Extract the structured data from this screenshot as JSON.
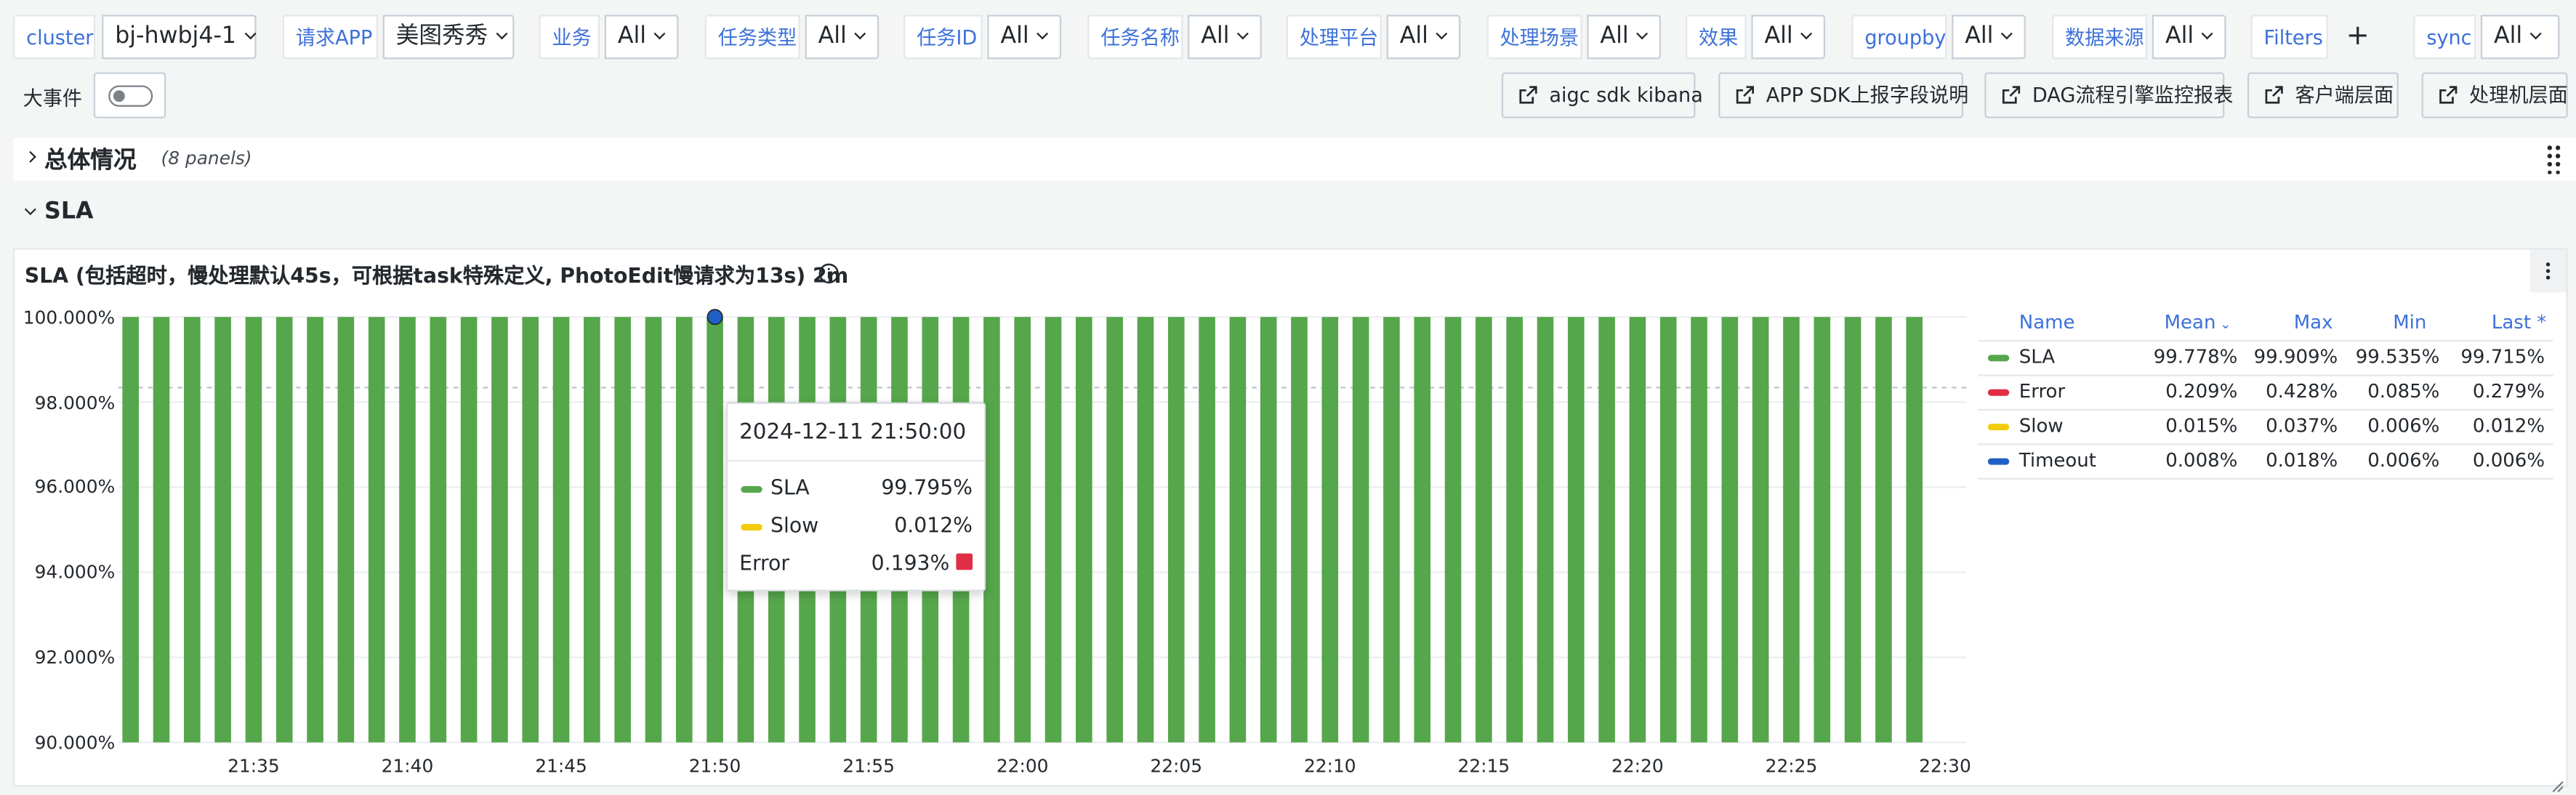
{
  "variables": {
    "cluster": {
      "label": "cluster",
      "value": "bj-hwbj4-1"
    },
    "app": {
      "label": "请求APP",
      "value": "美图秀秀"
    },
    "business": {
      "label": "业务",
      "value": "All"
    },
    "task_type": {
      "label": "任务类型",
      "value": "All"
    },
    "task_id": {
      "label": "任务ID",
      "value": "All"
    },
    "task_name": {
      "label": "任务名称",
      "value": "All"
    },
    "platform": {
      "label": "处理平台",
      "value": "All"
    },
    "scene": {
      "label": "处理场景",
      "value": "All"
    },
    "effect": {
      "label": "效果",
      "value": "All"
    },
    "groupby": {
      "label": "groupby",
      "value": "All"
    },
    "source": {
      "label": "数据来源",
      "value": "All"
    },
    "filters": {
      "label": "Filters",
      "add": "+"
    },
    "sync": {
      "label": "sync",
      "value": "All"
    },
    "big_event": {
      "label": "大事件"
    }
  },
  "links": {
    "kibana": "aigc sdk kibana",
    "sdk": "APP SDK上报字段说明",
    "dag": "DAG流程引擎监控报表",
    "client": "客户端层面",
    "handler": "处理机层面"
  },
  "rows": {
    "overview": {
      "title": "总体情况",
      "count": "(8 panels)"
    },
    "sla": {
      "title": "SLA"
    }
  },
  "panel": {
    "title": "SLA (包括超时，慢处理默认45s，可根据task特殊定义, PhotoEdit慢请求为13s) 2m"
  },
  "legend": {
    "headers": {
      "name": "Name",
      "mean": "Mean",
      "max": "Max",
      "min": "Min",
      "last": "Last *"
    },
    "rows": [
      {
        "name": "SLA",
        "color": "#56a64b",
        "mean": "99.778%",
        "max": "99.909%",
        "min": "99.535%",
        "last": "99.715%"
      },
      {
        "name": "Error",
        "color": "#e02f44",
        "mean": "0.209%",
        "max": "0.428%",
        "min": "0.085%",
        "last": "0.279%"
      },
      {
        "name": "Slow",
        "color": "#f2cc0c",
        "mean": "0.015%",
        "max": "0.037%",
        "min": "0.006%",
        "last": "0.012%"
      },
      {
        "name": "Timeout",
        "color": "#1f60c4",
        "mean": "0.008%",
        "max": "0.018%",
        "min": "0.006%",
        "last": "0.006%"
      }
    ]
  },
  "tooltip": {
    "time": "2024-12-11 21:50:00",
    "rows": [
      {
        "name": "SLA",
        "value": "99.795%",
        "color": "#56a64b"
      },
      {
        "name": "Slow",
        "value": "0.012%",
        "color": "#f2cc0c"
      },
      {
        "name": "Error",
        "value": "0.193%",
        "color": "#e02f44"
      }
    ]
  },
  "chart_data": {
    "type": "bar",
    "stacked": true,
    "ylim": [
      90,
      100
    ],
    "y_ticks": [
      "100.000%",
      "98.000%",
      "96.000%",
      "94.000%",
      "92.000%",
      "90.000%"
    ],
    "x_ticks": [
      "21:35",
      "21:40",
      "21:45",
      "21:50",
      "21:55",
      "22:00",
      "22:05",
      "22:10",
      "22:15",
      "22:20",
      "22:25",
      "22:30"
    ],
    "x_start": "21:31",
    "x_step_minutes": 1,
    "series": [
      {
        "name": "SLA",
        "color": "#56a64b",
        "values": [
          99.8,
          99.85,
          99.84,
          99.8,
          99.82,
          99.83,
          99.8,
          99.85,
          99.84,
          99.86,
          99.85,
          99.86,
          99.84,
          99.78,
          99.83,
          99.82,
          99.8,
          99.78,
          99.85,
          99.795,
          99.83,
          99.85,
          99.83,
          99.81,
          99.82,
          99.84,
          99.8,
          99.86,
          99.83,
          99.84,
          99.79,
          99.82,
          99.78,
          99.83,
          99.81,
          99.86,
          99.82,
          99.8,
          99.8,
          99.82,
          99.84,
          99.83,
          99.78,
          99.75,
          99.76,
          99.72,
          99.65,
          99.7,
          99.69,
          99.7,
          99.7,
          99.69,
          99.68,
          99.7,
          99.65,
          99.6,
          99.54,
          99.62,
          99.715
        ]
      },
      {
        "name": "Error",
        "color": "#e02f44",
        "values": [
          0.18,
          0.13,
          0.14,
          0.18,
          0.16,
          0.15,
          0.18,
          0.13,
          0.14,
          0.12,
          0.13,
          0.12,
          0.14,
          0.2,
          0.15,
          0.16,
          0.18,
          0.2,
          0.13,
          0.193,
          0.15,
          0.13,
          0.15,
          0.17,
          0.16,
          0.14,
          0.18,
          0.12,
          0.15,
          0.14,
          0.19,
          0.16,
          0.2,
          0.15,
          0.17,
          0.12,
          0.16,
          0.18,
          0.18,
          0.16,
          0.14,
          0.15,
          0.2,
          0.23,
          0.22,
          0.26,
          0.33,
          0.28,
          0.29,
          0.28,
          0.28,
          0.29,
          0.3,
          0.28,
          0.33,
          0.38,
          0.43,
          0.36,
          0.279
        ]
      },
      {
        "name": "Slow",
        "color": "#f2cc0c",
        "values": [
          0.01,
          0.01,
          0.01,
          0.01,
          0.01,
          0.01,
          0.01,
          0.01,
          0.01,
          0.01,
          0.01,
          0.01,
          0.01,
          0.01,
          0.01,
          0.01,
          0.01,
          0.01,
          0.01,
          0.012,
          0.01,
          0.01,
          0.01,
          0.01,
          0.01,
          0.01,
          0.01,
          0.01,
          0.01,
          0.01,
          0.01,
          0.01,
          0.01,
          0.01,
          0.01,
          0.01,
          0.01,
          0.01,
          0.01,
          0.01,
          0.01,
          0.01,
          0.01,
          0.01,
          0.01,
          0.01,
          0.01,
          0.01,
          0.01,
          0.01,
          0.01,
          0.01,
          0.01,
          0.01,
          0.01,
          0.01,
          0.02,
          0.01,
          0.012
        ]
      },
      {
        "name": "Timeout",
        "color": "#1f60c4",
        "values": [
          0.01,
          0.01,
          0.01,
          0.01,
          0.01,
          0.01,
          0.01,
          0.01,
          0.01,
          0.01,
          0.01,
          0.01,
          0.01,
          0.01,
          0.01,
          0.01,
          0.01,
          0.01,
          0.01,
          0.0,
          0.01,
          0.01,
          0.01,
          0.01,
          0.01,
          0.01,
          0.01,
          0.01,
          0.01,
          0.01,
          0.01,
          0.01,
          0.01,
          0.01,
          0.01,
          0.01,
          0.01,
          0.01,
          0.01,
          0.01,
          0.01,
          0.01,
          0.01,
          0.01,
          0.01,
          0.01,
          0.01,
          0.01,
          0.01,
          0.01,
          0.01,
          0.01,
          0.01,
          0.01,
          0.01,
          0.01,
          0.01,
          0.01,
          0.006
        ]
      }
    ]
  }
}
